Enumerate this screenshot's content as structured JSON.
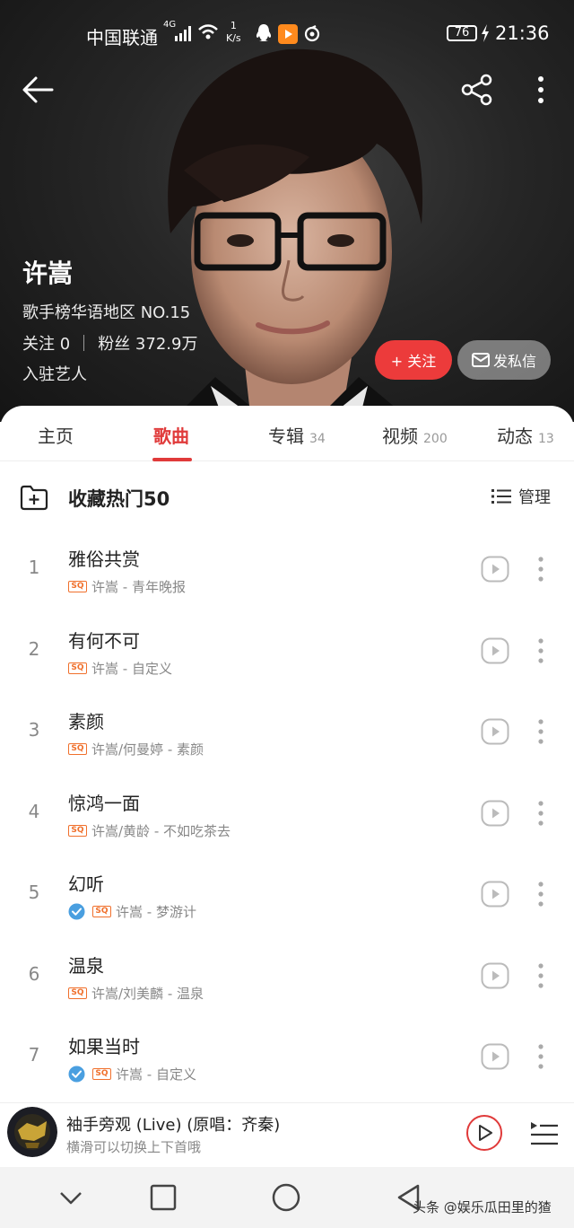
{
  "status_bar": {
    "carrier": "中国联通",
    "network": "4G",
    "speed_value": "1",
    "speed_unit": "K/s",
    "battery": "76",
    "time": "21:36"
  },
  "artist": {
    "name": "许嵩",
    "rank": "歌手榜华语地区 NO.15",
    "following": "关注 0",
    "fans": "粉丝 372.9万",
    "settled": "入驻艺人",
    "follow_button": "+ 关注",
    "message_button": "发私信"
  },
  "tabs": [
    {
      "label": "主页",
      "count": ""
    },
    {
      "label": "歌曲",
      "count": ""
    },
    {
      "label": "专辑",
      "count": "34"
    },
    {
      "label": "视频",
      "count": "200"
    },
    {
      "label": "动态",
      "count": "13"
    }
  ],
  "active_tab": "歌曲",
  "collect": {
    "label": "收藏热门50",
    "manage_label": "管理"
  },
  "songs": [
    {
      "rank": "1",
      "title": "雅俗共赏",
      "meta": "许嵩 - 青年晚报",
      "verified": false
    },
    {
      "rank": "2",
      "title": "有何不可",
      "meta": "许嵩 - 自定义",
      "verified": false
    },
    {
      "rank": "3",
      "title": "素颜",
      "meta": "许嵩/何曼婷 - 素颜",
      "verified": false
    },
    {
      "rank": "4",
      "title": "惊鸿一面",
      "meta": "许嵩/黄龄 - 不如吃茶去",
      "verified": false
    },
    {
      "rank": "5",
      "title": "幻听",
      "meta": "许嵩 - 梦游计",
      "verified": true
    },
    {
      "rank": "6",
      "title": "温泉",
      "meta": "许嵩/刘美麟 - 温泉",
      "verified": false
    },
    {
      "rank": "7",
      "title": "如果当时",
      "meta": "许嵩 - 自定义",
      "verified": true
    }
  ],
  "sq_badge": "SQ",
  "player": {
    "title": "袖手旁观 (Live) (原唱：齐秦)",
    "subtitle": "横滑可以切换上下首哦"
  },
  "watermark": "头条 @娱乐瓜田里的猹",
  "colors": {
    "accent": "#e03a3a",
    "follow_button": "#ec3b3b",
    "sq_badge": "#f0702c",
    "verified": "#4a9fe0"
  }
}
